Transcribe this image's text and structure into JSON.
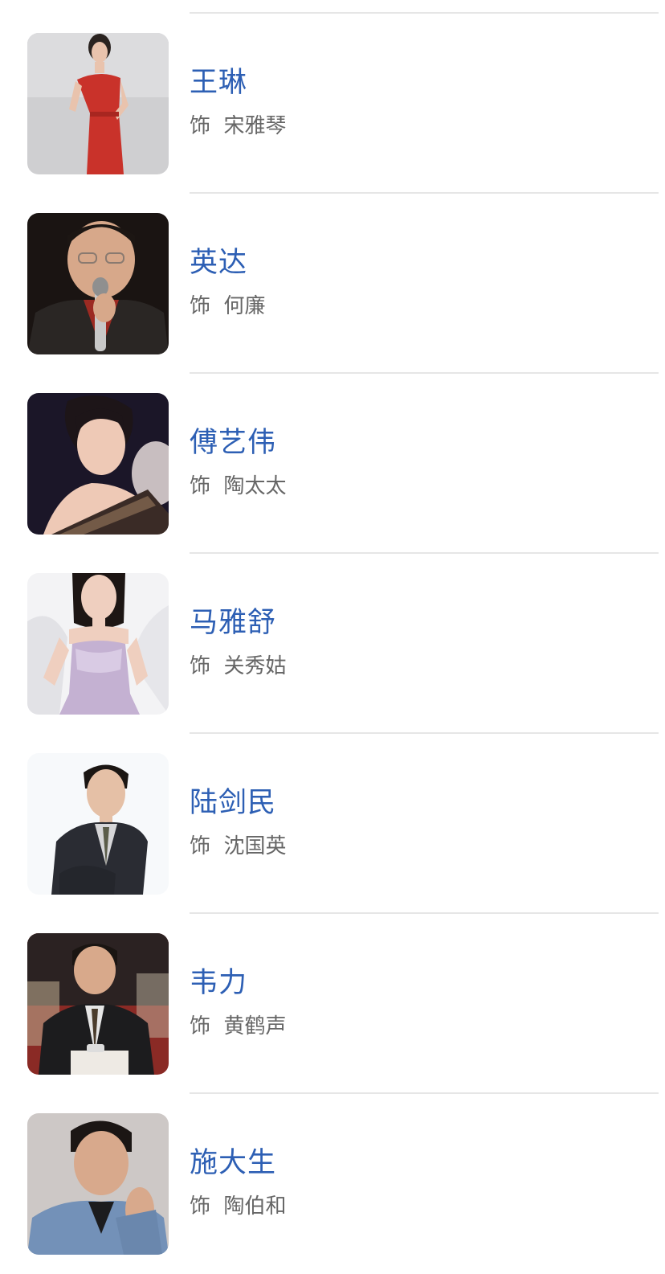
{
  "cast": [
    {
      "name": "王琳",
      "role_prefix": "饰",
      "role": "宋雅琴",
      "avatar": "portrait-woman-red-dress"
    },
    {
      "name": "英达",
      "role_prefix": "饰",
      "role": "何廉",
      "avatar": "portrait-man-microphone"
    },
    {
      "name": "傅艺伟",
      "role_prefix": "饰",
      "role": "陶太太",
      "avatar": "portrait-woman-dark-background"
    },
    {
      "name": "马雅舒",
      "role_prefix": "饰",
      "role": "关秀姑",
      "avatar": "portrait-woman-lavender-gown"
    },
    {
      "name": "陆剑民",
      "role_prefix": "饰",
      "role": "沈国英",
      "avatar": "portrait-man-dark-suit"
    },
    {
      "name": "韦力",
      "role_prefix": "饰",
      "role": "黄鹤声",
      "avatar": "portrait-man-press-conference"
    },
    {
      "name": "施大生",
      "role_prefix": "饰",
      "role": "陶伯和",
      "avatar": "portrait-man-denim-jacket"
    }
  ],
  "colors": {
    "name_link": "#2d5fb4",
    "role_text": "#666666",
    "divider": "#e6e6e6"
  }
}
